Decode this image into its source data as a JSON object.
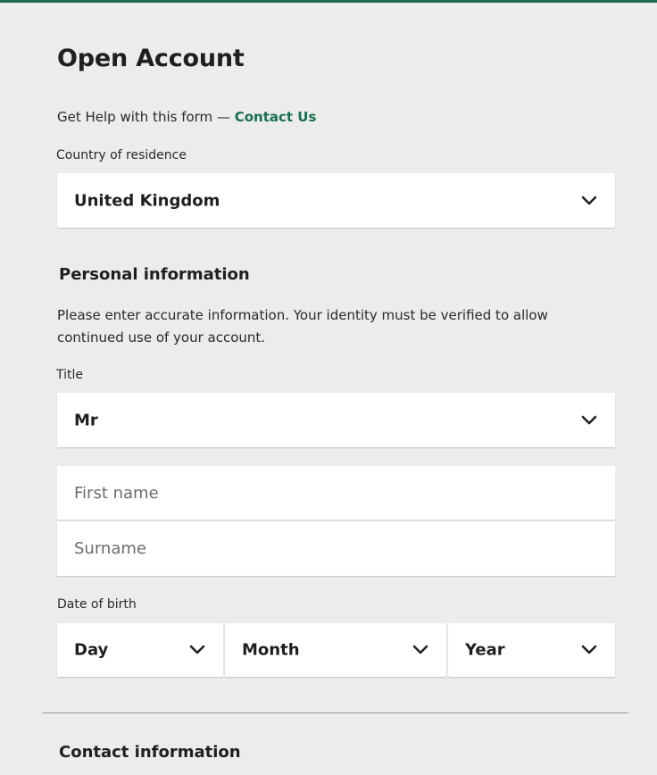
{
  "header": {
    "title": "Open Account"
  },
  "help": {
    "prefix": "Get Help with this form — ",
    "link": "Contact Us"
  },
  "country": {
    "label": "Country of residence",
    "value": "United Kingdom"
  },
  "personal": {
    "heading": "Personal information",
    "description": "Please enter accurate information. Your identity must be verified to allow continued use of your account.",
    "title_label": "Title",
    "title_value": "Mr",
    "first_name_placeholder": "First name",
    "surname_placeholder": "Surname"
  },
  "dob": {
    "label": "Date of birth",
    "day": "Day",
    "month": "Month",
    "year": "Year"
  },
  "contact": {
    "heading": "Contact information"
  },
  "colors": {
    "accent": "#16704d",
    "topbar": "#1f6b4e",
    "background": "#ebeceb"
  },
  "icons": {
    "select_chevron": "chevron-down-icon"
  }
}
